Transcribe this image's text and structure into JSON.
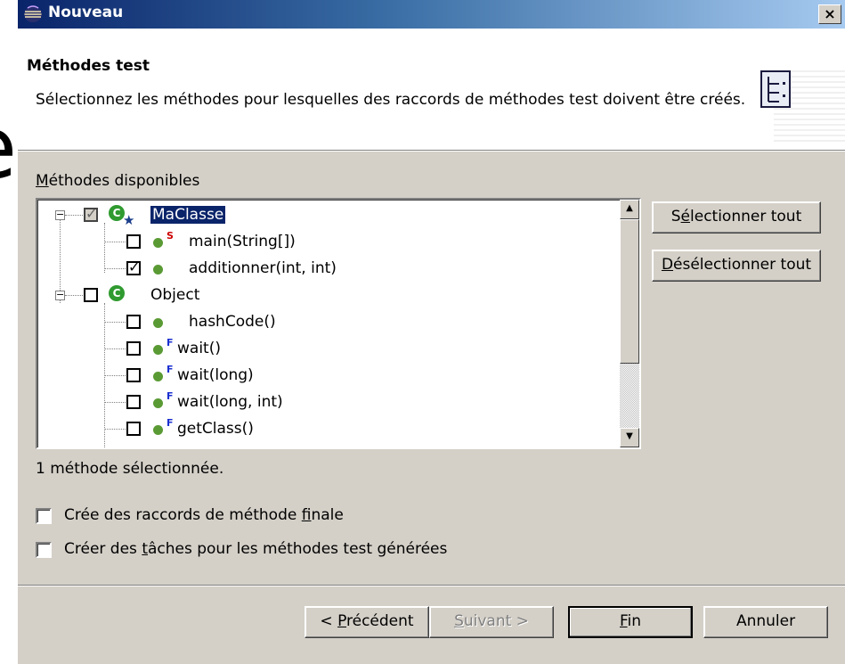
{
  "background_glyph": "e",
  "window": {
    "title": "Nouveau",
    "close_glyph": "×"
  },
  "header": {
    "title": "Méthodes test",
    "description": "Sélectionnez les méthodes pour lesquelles des raccords de méthodes test doivent être créés."
  },
  "available_methods": {
    "label_mnemonic": "M",
    "label_rest": "éthodes disponibles",
    "tree": {
      "class1": {
        "name": "MaClasse",
        "icon": "class-icon",
        "icon_letter": "C",
        "checked": "partial"
      },
      "class1_methods": [
        {
          "label": "main(String[])",
          "modifier": "S",
          "checked": false
        },
        {
          "label": "additionner(int, int)",
          "modifier": "",
          "checked": true
        }
      ],
      "class2": {
        "name": "Object",
        "icon": "class-icon",
        "icon_letter": "C",
        "checked": false
      },
      "class2_methods": [
        {
          "label": "hashCode()",
          "modifier": "",
          "checked": false
        },
        {
          "label": "wait()",
          "modifier": "F",
          "checked": false
        },
        {
          "label": "wait(long)",
          "modifier": "F",
          "checked": false
        },
        {
          "label": "wait(long, int)",
          "modifier": "F",
          "checked": false
        },
        {
          "label": "getClass()",
          "modifier": "F",
          "checked": false
        }
      ],
      "expander_glyph": "−",
      "check_glyph": "✓"
    },
    "select_all": {
      "before": "S",
      "mnemonic": "é",
      "after": "lectionner tout"
    },
    "deselect_all": {
      "mnemonic": "D",
      "after": "ésélectionner tout"
    }
  },
  "status_text": "1 méthode sélectionnée.",
  "options": [
    {
      "before": "Crée des raccords de méthode ",
      "mnemonic": "f",
      "after": "inale",
      "checked": false
    },
    {
      "before": "Créer des ",
      "mnemonic": "t",
      "after": "âches pour les méthodes test générées",
      "checked": false
    }
  ],
  "buttons": {
    "back": {
      "before": "< ",
      "mnemonic": "P",
      "after": "récédent",
      "enabled": true
    },
    "next": {
      "mnemonic": "S",
      "after": "uivant >",
      "enabled": false
    },
    "finish": {
      "mnemonic": "F",
      "after": "in",
      "enabled": true,
      "default": true
    },
    "cancel": {
      "label": "Annuler",
      "enabled": true
    }
  },
  "colors": {
    "dialog_bg": "#d4d0c8",
    "titlebar_start": "#0a246a",
    "titlebar_end": "#a6caf0",
    "selection_bg": "#0a246a",
    "class_icon_green": "#2f9a2f",
    "method_icon_green": "#5a9a34",
    "static_marker_red": "#cc0000",
    "final_marker_blue": "#1a2fd0"
  }
}
